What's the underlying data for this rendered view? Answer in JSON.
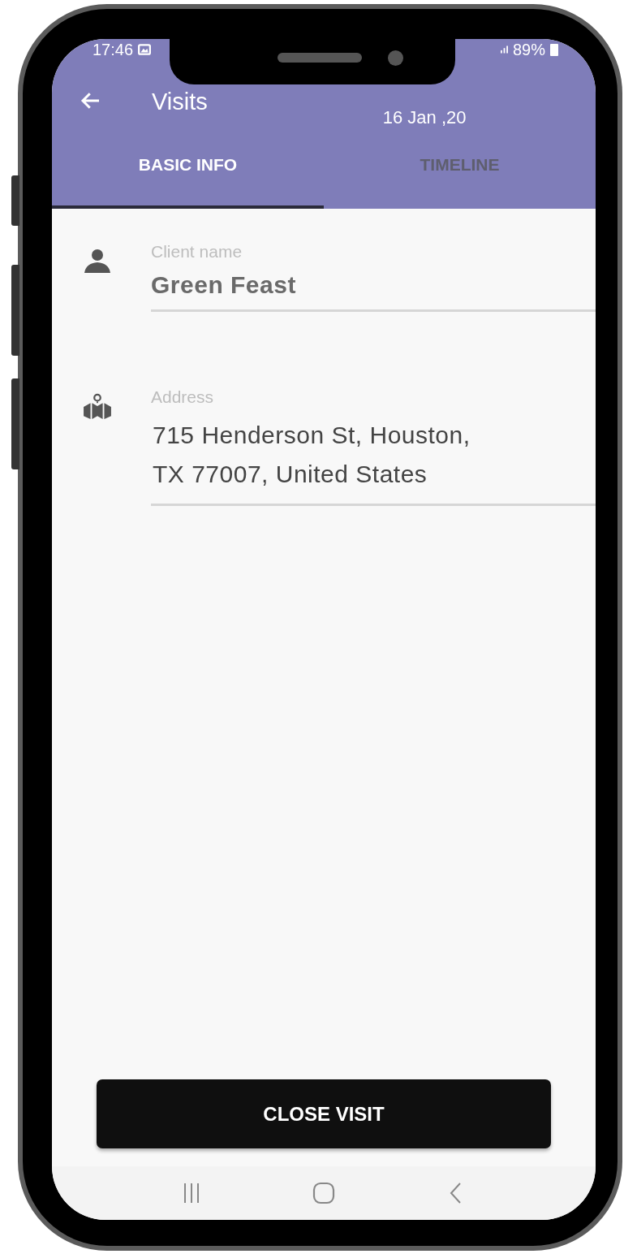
{
  "status_bar": {
    "time": "17:46",
    "battery": "89%"
  },
  "app_bar": {
    "title": "Visits",
    "date": "16 Jan ,20"
  },
  "tabs": [
    {
      "label": "BASIC INFO",
      "selected": true
    },
    {
      "label": "TIMELINE",
      "selected": false
    }
  ],
  "fields": [
    {
      "kind": "person",
      "label": "Client name",
      "value": "Green Feast",
      "bold": true
    },
    {
      "kind": "map",
      "label": "Address",
      "value": "715 Henderson St, Houston,\nTX 77007, United States",
      "bold": false
    }
  ],
  "primary_button": {
    "label": "CLOSE VISIT"
  }
}
